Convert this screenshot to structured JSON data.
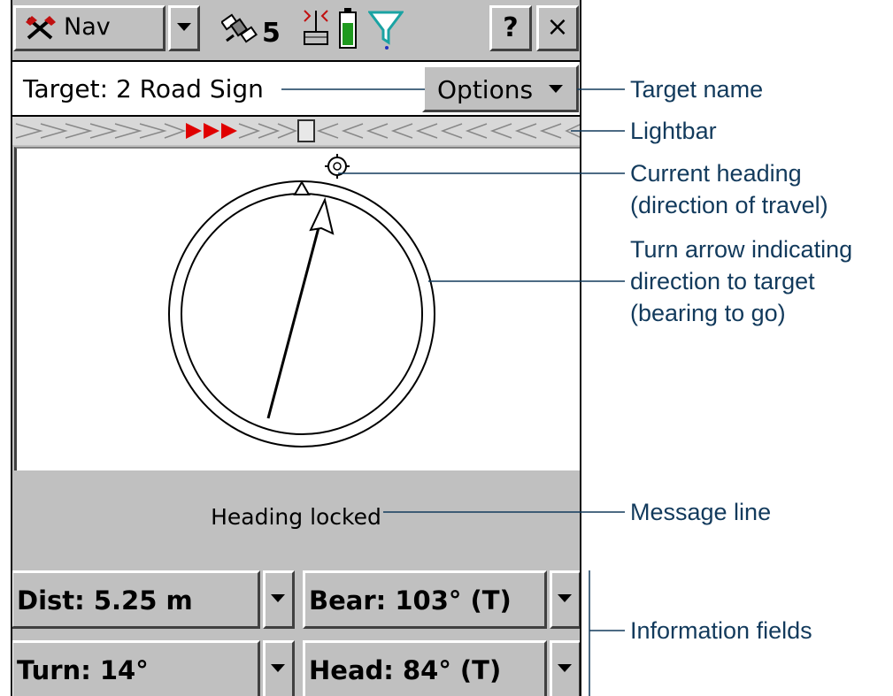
{
  "titlebar": {
    "nav_label": "Nav",
    "satellite_count": "5",
    "help_label": "?",
    "close_label": "×"
  },
  "target": {
    "text": "Target: 2 Road Sign",
    "options_label": "Options"
  },
  "message_line": "Heading locked",
  "fields": [
    {
      "label": "Dist: 5.25 m"
    },
    {
      "label": "Bear: 103° (T)"
    },
    {
      "label": "Turn: 14°"
    },
    {
      "label": "Head: 84° (T)"
    }
  ],
  "callouts": {
    "target_name": "Target name",
    "lightbar": "Lightbar",
    "current_heading_1": "Current heading",
    "current_heading_2": "(direction of travel)",
    "turn_arrow_1": "Turn arrow indicating",
    "turn_arrow_2": "direction to target",
    "turn_arrow_3": "(bearing to go)",
    "message_line": "Message line",
    "information_fields": "Information fields"
  },
  "colors": {
    "window_gray": "#c0c0c0",
    "callout_text": "#123a5c",
    "lightbar_arrow": "#e00000",
    "battery_fill": "#1f9a1f",
    "filter_color": "#1aa3a3"
  },
  "icons": [
    "nav-tools-icon",
    "satellite-icon",
    "radio-antenna-icon",
    "battery-icon",
    "filter-icon",
    "current-heading-icon"
  ]
}
